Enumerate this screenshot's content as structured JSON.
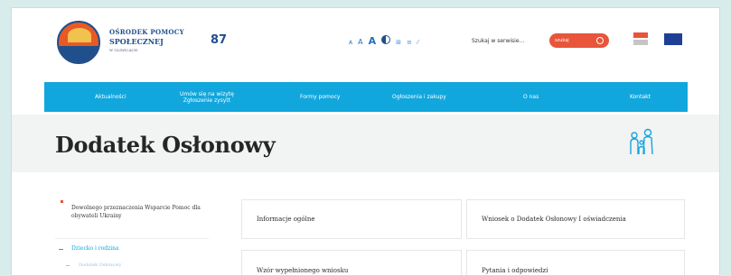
{
  "header": {
    "logo": {
      "line1": "OŚRODEK POMOCY",
      "line2": "SPOŁECZNEJ",
      "line3": "W GLIWICACH"
    },
    "brand_mark": "87",
    "accessibility": {
      "font_small": "A",
      "font_medium": "A",
      "font_large": "A",
      "icons": [
        "contrast-icon",
        "grid-icon",
        "text-icon",
        "link-icon"
      ]
    },
    "search": {
      "placeholder": "Szukaj w serwisie...",
      "button_label": "szukaj"
    }
  },
  "nav": {
    "items": [
      {
        "label": "Aktualności"
      },
      {
        "label": "Umów się na wizytę\nZgłoszenie zysytt"
      },
      {
        "label": "Formy pomocy"
      },
      {
        "label": "Ogłoszenia i zakupy"
      },
      {
        "label": "O nas"
      },
      {
        "label": "Kontakt"
      }
    ]
  },
  "page": {
    "title": "Dodatek Osłonowy"
  },
  "sidebar": {
    "items": [
      {
        "label": "Dowolnego przeznaczenia Wsparcie Pomoc dla obywateli Ukrainy"
      },
      {
        "label": "Dziecko i rodzina"
      },
      {
        "label": "Dodatek Osłonowy"
      }
    ]
  },
  "cards": [
    {
      "label": "Informacje ogólne"
    },
    {
      "label": "Wniosek o Dodatek Osłonowy I oświadczenia"
    },
    {
      "label": "Wzór wypełnionego wniosku"
    },
    {
      "label": "Pytania i odpowiedzi"
    }
  ],
  "colors": {
    "accent": "#11a7dd",
    "orange": "#e8553a",
    "brand_blue": "#1f4f8c"
  }
}
